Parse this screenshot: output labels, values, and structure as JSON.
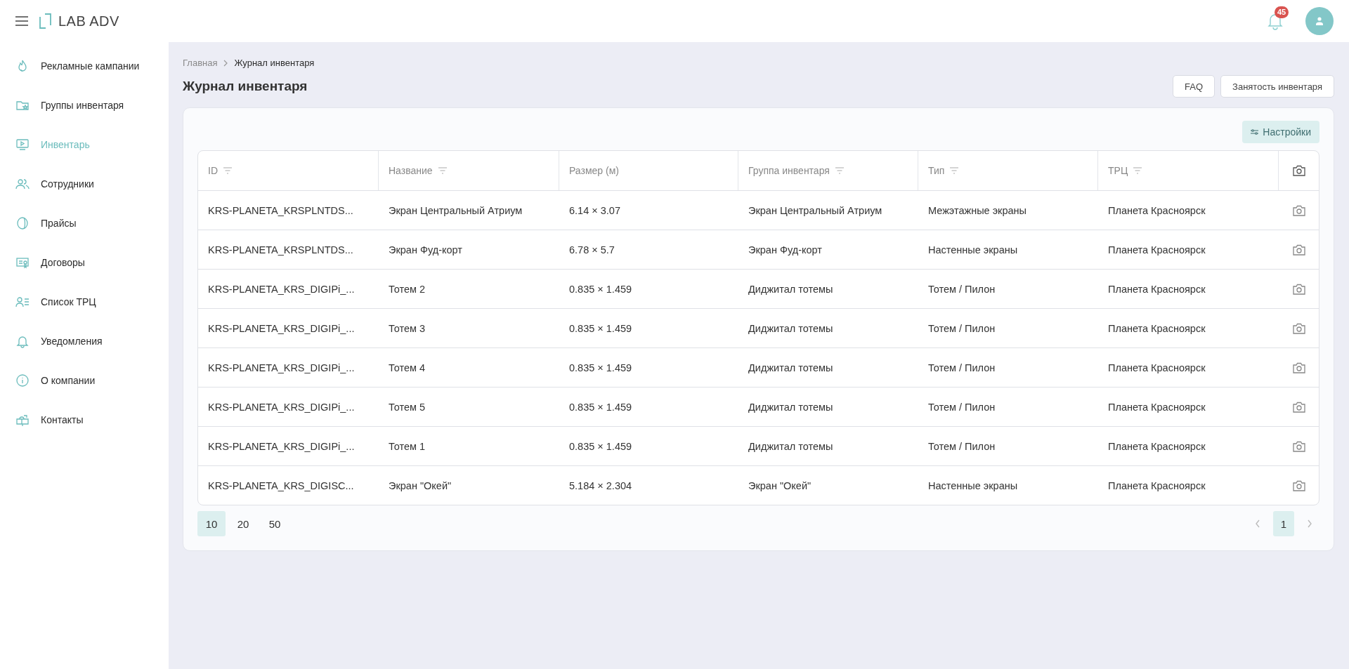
{
  "header": {
    "logo": "LAB ADV",
    "notification_count": "45"
  },
  "sidebar": {
    "items": [
      {
        "label": "Рекламные кампании",
        "selected": false
      },
      {
        "label": "Группы инвентаря",
        "selected": false
      },
      {
        "label": "Инвентарь",
        "selected": true
      },
      {
        "label": "Сотрудники",
        "selected": false
      },
      {
        "label": "Прайсы",
        "selected": false
      },
      {
        "label": "Договоры",
        "selected": false
      },
      {
        "label": "Список ТРЦ",
        "selected": false
      },
      {
        "label": "Уведомления",
        "selected": false
      },
      {
        "label": "О компании",
        "selected": false
      },
      {
        "label": "Контакты",
        "selected": false
      }
    ]
  },
  "breadcrumbs": [
    "Главная",
    "Журнал инвентаря"
  ],
  "page_title": "Журнал инвентаря",
  "actions": [
    "FAQ",
    "Занятость инвентаря"
  ],
  "settings_button": "Настройки",
  "table": {
    "columns": [
      {
        "label": "ID",
        "filterable": true
      },
      {
        "label": "Название",
        "filterable": true
      },
      {
        "label": "Размер (м)",
        "filterable": false
      },
      {
        "label": "Группа инвентаря",
        "filterable": true
      },
      {
        "label": "Тип",
        "filterable": true
      },
      {
        "label": "ТРЦ",
        "filterable": true
      }
    ],
    "rows": [
      [
        "KRS-PLANETA_KRSPLNTDS...",
        "Экран Центральный Атриум",
        "6.14 × 3.07",
        "Экран Центральный Атриум",
        "Межэтажные экраны",
        "Планета Красноярск"
      ],
      [
        "KRS-PLANETA_KRSPLNTDS...",
        "Экран Фуд-корт",
        "6.78 × 5.7",
        "Экран Фуд-корт",
        "Настенные экраны",
        "Планета Красноярск"
      ],
      [
        "KRS-PLANETA_KRS_DIGIPi_...",
        "Тотем 2",
        "0.835 × 1.459",
        "Диджитал тотемы",
        "Тотем / Пилон",
        "Планета Красноярск"
      ],
      [
        "KRS-PLANETA_KRS_DIGIPi_...",
        "Тотем 3",
        "0.835 × 1.459",
        "Диджитал тотемы",
        "Тотем / Пилон",
        "Планета Красноярск"
      ],
      [
        "KRS-PLANETA_KRS_DIGIPi_...",
        "Тотем 4",
        "0.835 × 1.459",
        "Диджитал тотемы",
        "Тотем / Пилон",
        "Планета Красноярск"
      ],
      [
        "KRS-PLANETA_KRS_DIGIPi_...",
        "Тотем 5",
        "0.835 × 1.459",
        "Диджитал тотемы",
        "Тотем / Пилон",
        "Планета Красноярск"
      ],
      [
        "KRS-PLANETA_KRS_DIGIPi_...",
        "Тотем 1",
        "0.835 × 1.459",
        "Диджитал тотемы",
        "Тотем / Пилон",
        "Планета Красноярск"
      ],
      [
        "KRS-PLANETA_KRS_DIGISC...",
        "Экран \"Окей\"",
        "5.184 × 2.304",
        "Экран \"Окей\"",
        "Настенные экраны",
        "Планета Красноярск"
      ]
    ]
  },
  "pagination": {
    "page_sizes": [
      {
        "label": "10",
        "selected": true
      },
      {
        "label": "20",
        "selected": false
      },
      {
        "label": "50",
        "selected": false
      }
    ],
    "pages": [
      {
        "label": "1",
        "selected": true
      }
    ]
  }
}
